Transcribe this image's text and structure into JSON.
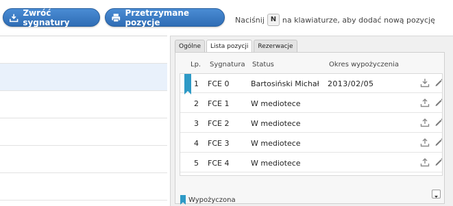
{
  "toolbar": {
    "return_label": "Zwróć sygnatury",
    "held_label": "Przetrzymane pozycje",
    "hint_before": "Naciśnij",
    "hint_key": "N",
    "hint_after": "na klawiaturze, aby dodać nową pozycję"
  },
  "tabs": [
    {
      "label": "Ogólne"
    },
    {
      "label": "Lista pozycji"
    },
    {
      "label": "Rezerwacje"
    }
  ],
  "table": {
    "headers": {
      "lp": "Lp.",
      "signature": "Sygnatura",
      "status": "Status",
      "period": "Okres wypożyczenia"
    },
    "rows": [
      {
        "lp": "1",
        "signature": "FCE 0",
        "status": "Bartosiński Michał",
        "period": "2013/02/05",
        "borrowed": true
      },
      {
        "lp": "2",
        "signature": "FCE 1",
        "status": "W mediotece",
        "period": ""
      },
      {
        "lp": "3",
        "signature": "FCE 2",
        "status": "W mediotece",
        "period": ""
      },
      {
        "lp": "4",
        "signature": "FCE 3",
        "status": "W mediotece",
        "period": ""
      },
      {
        "lp": "5",
        "signature": "FCE 4",
        "status": "W mediotece",
        "period": ""
      }
    ]
  },
  "legend": {
    "label": "Wypożyczona"
  },
  "colors": {
    "accent": "#2f6db5",
    "bookmark": "#2e9ac6",
    "selected_row": "#e9f1fb"
  }
}
